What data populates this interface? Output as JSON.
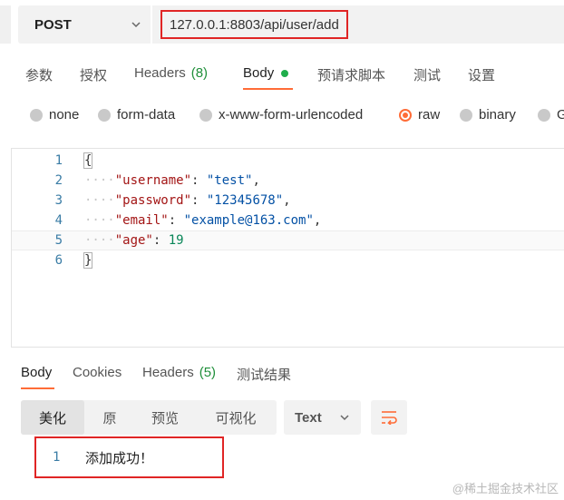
{
  "request": {
    "method": "POST",
    "url": "127.0.0.1:8803/api/user/add"
  },
  "request_tabs": [
    {
      "label": "参数"
    },
    {
      "label": "授权"
    },
    {
      "label": "Headers",
      "count": "(8)"
    },
    {
      "label": "Body"
    },
    {
      "label": "预请求脚本"
    },
    {
      "label": "测试"
    },
    {
      "label": "设置"
    }
  ],
  "body_types": [
    {
      "label": "none"
    },
    {
      "label": "form-data"
    },
    {
      "label": "x-www-form-urlencoded"
    },
    {
      "label": "raw",
      "selected": true
    },
    {
      "label": "binary"
    },
    {
      "label": "G"
    }
  ],
  "editor": {
    "line_numbers": [
      "1",
      "2",
      "3",
      "4",
      "5",
      "6"
    ],
    "open_brace": "{",
    "close_brace": "}",
    "indent": "····",
    "fields": [
      {
        "key": "\"username\"",
        "value": "\"test\"",
        "trail": ","
      },
      {
        "key": "\"password\"",
        "value": "\"12345678\"",
        "trail": ","
      },
      {
        "key": "\"email\"",
        "value": "\"example@163.com\"",
        "trail": ","
      },
      {
        "key": "\"age\"",
        "value": "19",
        "trail": ""
      }
    ]
  },
  "response_tabs": [
    {
      "label": "Body"
    },
    {
      "label": "Cookies"
    },
    {
      "label": "Headers",
      "count": "(5)"
    },
    {
      "label": "测试结果"
    }
  ],
  "view_modes": [
    "美化",
    "原",
    "预览",
    "可视化"
  ],
  "format": "Text",
  "output": {
    "line_number": "1",
    "text": "添加成功！"
  },
  "watermark": "@稀土掘金技术社区",
  "colors": {
    "accent": "#ff6c37",
    "highlight_border": "#e02525",
    "count_green": "#1f8f3a"
  }
}
